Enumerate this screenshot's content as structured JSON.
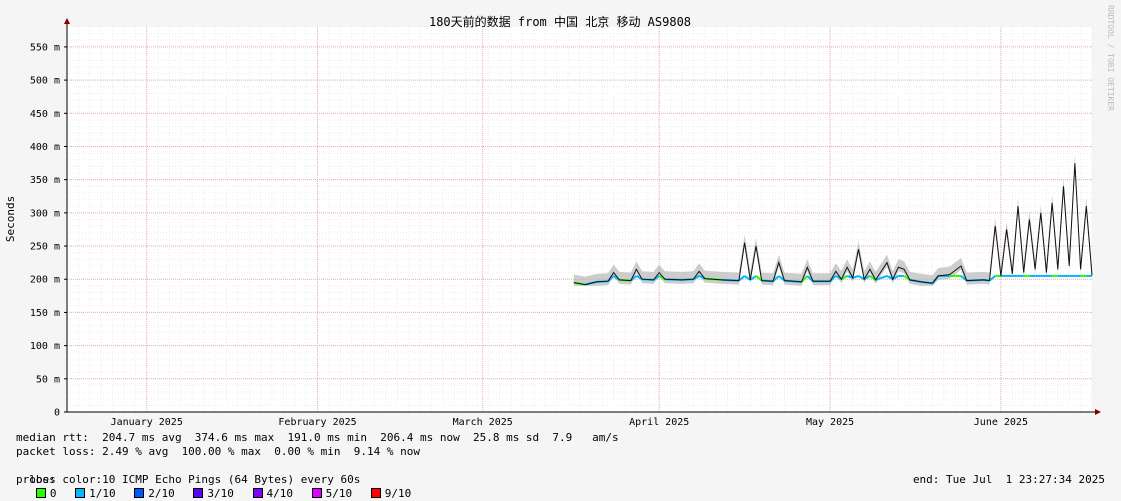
{
  "chart_data": {
    "type": "line",
    "title": "180天前的数据 from 中国 北京 移动 AS9808",
    "ylabel": "Seconds",
    "ylim": [
      0,
      0.58
    ],
    "yticks": [
      {
        "v": 0,
        "label": "0"
      },
      {
        "v": 0.05,
        "label": "50 m"
      },
      {
        "v": 0.1,
        "label": "100 m"
      },
      {
        "v": 0.15,
        "label": "150 m"
      },
      {
        "v": 0.2,
        "label": "200 m"
      },
      {
        "v": 0.25,
        "label": "250 m"
      },
      {
        "v": 0.3,
        "label": "300 m"
      },
      {
        "v": 0.35,
        "label": "350 m"
      },
      {
        "v": 0.4,
        "label": "400 m"
      },
      {
        "v": 0.45,
        "label": "450 m"
      },
      {
        "v": 0.5,
        "label": "500 m"
      },
      {
        "v": 0.55,
        "label": "550 m"
      }
    ],
    "xrange": [
      "2025-01-02",
      "2025-07-01"
    ],
    "xticks": [
      {
        "date": "2025-01-16",
        "label": "January 2025"
      },
      {
        "date": "2025-02-15",
        "label": "February 2025"
      },
      {
        "date": "2025-03-16",
        "label": "March 2025"
      },
      {
        "date": "2025-04-16",
        "label": "April 2025"
      },
      {
        "date": "2025-05-16",
        "label": "May 2025"
      },
      {
        "date": "2025-06-15",
        "label": "June 2025"
      }
    ],
    "grid": true,
    "series": [
      {
        "name": "median rtt",
        "color": "#000000",
        "points": [
          [
            "2025-04-01",
            0.195
          ],
          [
            "2025-04-03",
            0.192
          ],
          [
            "2025-04-05",
            0.196
          ],
          [
            "2025-04-07",
            0.197
          ],
          [
            "2025-04-08",
            0.21
          ],
          [
            "2025-04-09",
            0.199
          ],
          [
            "2025-04-11",
            0.198
          ],
          [
            "2025-04-12",
            0.215
          ],
          [
            "2025-04-13",
            0.2
          ],
          [
            "2025-04-15",
            0.199
          ],
          [
            "2025-04-16",
            0.21
          ],
          [
            "2025-04-17",
            0.2
          ],
          [
            "2025-04-20",
            0.199
          ],
          [
            "2025-04-22",
            0.2
          ],
          [
            "2025-04-23",
            0.212
          ],
          [
            "2025-04-24",
            0.201
          ],
          [
            "2025-04-27",
            0.199
          ],
          [
            "2025-04-30",
            0.198
          ],
          [
            "2025-05-01",
            0.255
          ],
          [
            "2025-05-02",
            0.199
          ],
          [
            "2025-05-03",
            0.25
          ],
          [
            "2025-05-04",
            0.198
          ],
          [
            "2025-05-06",
            0.197
          ],
          [
            "2025-05-07",
            0.225
          ],
          [
            "2025-05-08",
            0.198
          ],
          [
            "2025-05-11",
            0.196
          ],
          [
            "2025-05-12",
            0.218
          ],
          [
            "2025-05-13",
            0.197
          ],
          [
            "2025-05-16",
            0.197
          ],
          [
            "2025-05-17",
            0.212
          ],
          [
            "2025-05-18",
            0.2
          ],
          [
            "2025-05-19",
            0.218
          ],
          [
            "2025-05-20",
            0.202
          ],
          [
            "2025-05-21",
            0.245
          ],
          [
            "2025-05-22",
            0.2
          ],
          [
            "2025-05-23",
            0.215
          ],
          [
            "2025-05-24",
            0.199
          ],
          [
            "2025-05-26",
            0.225
          ],
          [
            "2025-05-27",
            0.2
          ],
          [
            "2025-05-28",
            0.218
          ],
          [
            "2025-05-29",
            0.215
          ],
          [
            "2025-05-30",
            0.199
          ],
          [
            "2025-06-01",
            0.196
          ],
          [
            "2025-06-03",
            0.194
          ],
          [
            "2025-06-04",
            0.205
          ],
          [
            "2025-06-06",
            0.207
          ],
          [
            "2025-06-08",
            0.22
          ],
          [
            "2025-06-09",
            0.198
          ],
          [
            "2025-06-12",
            0.199
          ],
          [
            "2025-06-13",
            0.198
          ],
          [
            "2025-06-14",
            0.28
          ],
          [
            "2025-06-15",
            0.205
          ],
          [
            "2025-06-16",
            0.275
          ],
          [
            "2025-06-17",
            0.208
          ],
          [
            "2025-06-18",
            0.31
          ],
          [
            "2025-06-19",
            0.21
          ],
          [
            "2025-06-20",
            0.29
          ],
          [
            "2025-06-21",
            0.215
          ],
          [
            "2025-06-22",
            0.3
          ],
          [
            "2025-06-23",
            0.21
          ],
          [
            "2025-06-24",
            0.315
          ],
          [
            "2025-06-25",
            0.215
          ],
          [
            "2025-06-26",
            0.34
          ],
          [
            "2025-06-27",
            0.22
          ],
          [
            "2025-06-28",
            0.375
          ],
          [
            "2025-06-29",
            0.215
          ],
          [
            "2025-06-30",
            0.31
          ],
          [
            "2025-07-01",
            0.206
          ]
        ]
      }
    ]
  },
  "side_label": "RRDTOOL / TOBI OETIKER",
  "stats": {
    "median_rtt": "median rtt:  204.7 ms avg  374.6 ms max  191.0 ms min  206.4 ms now  25.8 ms sd  7.9   am/s",
    "packet_loss": "packet loss: 2.49 % avg  100.00 % max  0.00 % min  9.14 % now",
    "loss_color_label": "loss color:",
    "loss_colors": [
      {
        "label": "0",
        "color": "#26ff00"
      },
      {
        "label": "1/10",
        "color": "#00b8ff"
      },
      {
        "label": "2/10",
        "color": "#0059ff"
      },
      {
        "label": "3/10",
        "color": "#5e00ff"
      },
      {
        "label": "4/10",
        "color": "#7e00ff"
      },
      {
        "label": "5/10",
        "color": "#dd00ff"
      },
      {
        "label": "9/10",
        "color": "#ff0000"
      }
    ],
    "probe": "probe:       10 ICMP Echo Pings (64 Bytes) every 60s",
    "end": "end: Tue Jul  1 23:27:34 2025"
  }
}
